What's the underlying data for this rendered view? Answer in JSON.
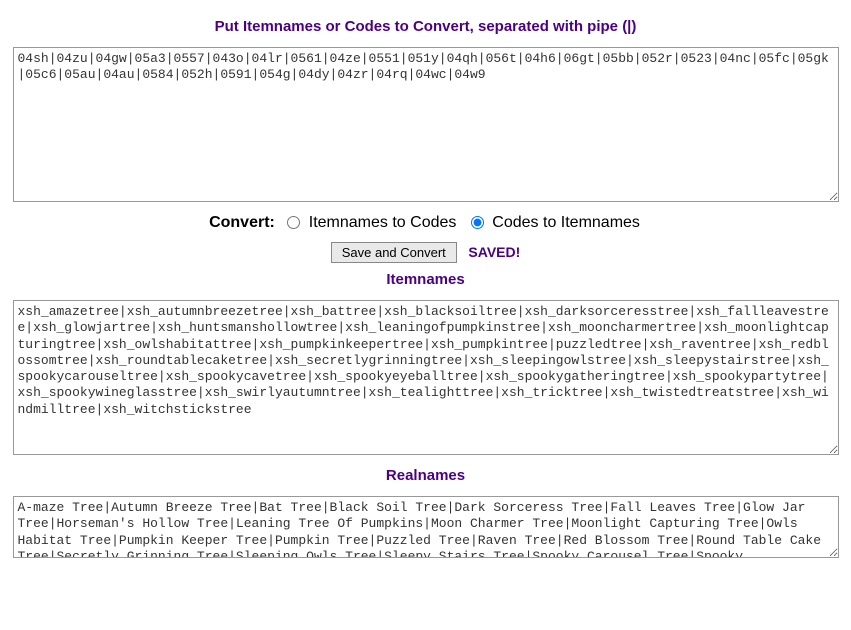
{
  "headings": {
    "input": "Put Itemnames or Codes to Convert, separated with pipe (|)",
    "itemnames": "Itemnames",
    "realnames": "Realnames"
  },
  "convert": {
    "label": "Convert:",
    "option_itemnames": "Itemnames to Codes",
    "option_codes": "Codes to Itemnames"
  },
  "button_label": "Save and Convert",
  "saved_label": "SAVED!",
  "input_value": "04sh|04zu|04gw|05a3|0557|043o|04lr|0561|04ze|0551|051y|04qh|056t|04h6|06gt|05bb|052r|0523|04nc|05fc|05gk|05c6|05au|04au|0584|052h|0591|054g|04dy|04zr|04rq|04wc|04w9",
  "itemnames_value": "xsh_amazetree|xsh_autumnbreezetree|xsh_battree|xsh_blacksoiltree|xsh_darksorceresstree|xsh_fallleavestree|xsh_glowjartree|xsh_huntsmanshollowtree|xsh_leaningofpumpkinstree|xsh_mooncharmertree|xsh_moonlightcapturingtree|xsh_owlshabitattree|xsh_pumpkinkeepertree|xsh_pumpkintree|puzzledtree|xsh_raventree|xsh_redblossomtree|xsh_roundtablecaketree|xsh_secretlygrinningtree|xsh_sleepingowlstree|xsh_sleepystairstree|xsh_spookycarouseltree|xsh_spookycavetree|xsh_spookyeyeballtree|xsh_spookygatheringtree|xsh_spookypartytree|xsh_spookywineglasstree|xsh_swirlyautumntree|xsh_tealighttree|xsh_tricktree|xsh_twistedtreatstree|xsh_windmilltree|xsh_witchstickstree",
  "realnames_value": "A-maze Tree|Autumn Breeze Tree|Bat Tree|Black Soil Tree|Dark Sorceress Tree|Fall Leaves Tree|Glow Jar Tree|Horseman's Hollow Tree|Leaning Tree Of Pumpkins|Moon Charmer Tree|Moonlight Capturing Tree|Owls Habitat Tree|Pumpkin Keeper Tree|Pumpkin Tree|Puzzled Tree|Raven Tree|Red Blossom Tree|Round Table Cake Tree|Secretly Grinning Tree|Sleeping Owls Tree|Sleepy Stairs Tree|Spooky Carousel Tree|Spooky"
}
